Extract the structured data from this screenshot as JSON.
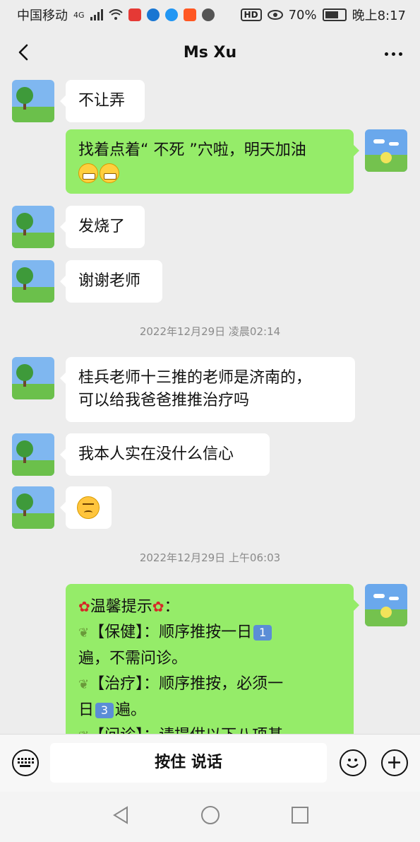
{
  "status_bar": {
    "carrier": "中国移动",
    "network": "4G",
    "hd_badge": "HD",
    "battery_percent": "70%",
    "time": "晚上8:17"
  },
  "header": {
    "title": "Ms Xu"
  },
  "messages": [
    {
      "side": "in",
      "text": "不让弄"
    },
    {
      "side": "out",
      "text": "找着点着“ 不死 ”穴啦，明天加油"
    },
    {
      "side": "in",
      "text": "发烧了"
    },
    {
      "side": "in",
      "text": "谢谢老师"
    },
    {
      "side": "in",
      "text_line1": "桂兵老师十三推的老师是济南的，",
      "text_line2": "可以给我爸爸推推治疗吗"
    },
    {
      "side": "in",
      "text": "我本人实在没什么信心"
    }
  ],
  "timestamps": {
    "t1": "2022年12月29日 凌晨02:14",
    "t2": "2022年12月29日 上午06:03"
  },
  "tips": {
    "title": "温馨提示",
    "line1": "【保健】：顺序推按一日",
    "keycap1": "1",
    "line1b": "遍，不需问诊。",
    "line2": "【治疗】：顺序推按，必须一",
    "line2b_prefix": "日",
    "keycap3": "3",
    "line2b_suffix": "遍。",
    "line3": "【问诊】：请提供以下八项基"
  },
  "input_bar": {
    "hold_to_talk": "按住 说话"
  },
  "icons": {
    "keyboard": "keyboard-icon",
    "emoji": "emoji-icon",
    "plus": "plus-icon"
  },
  "colors": {
    "background": "#ededed",
    "bubble_in": "#ffffff",
    "bubble_out": "#95ec69"
  }
}
